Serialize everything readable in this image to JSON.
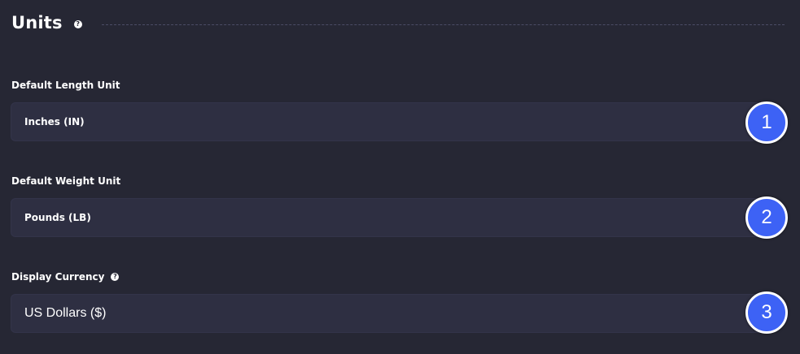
{
  "section": {
    "title": "Units",
    "help_icon": "question-circle-icon"
  },
  "fields": [
    {
      "label": "Default Length Unit",
      "value": "Inches (IN)",
      "marker": "1"
    },
    {
      "label": "Default Weight Unit",
      "value": "Pounds (LB)",
      "marker": "2"
    },
    {
      "label": "Display Currency",
      "value": "US Dollars ($)",
      "marker": "3",
      "help_icon": "question-circle-icon"
    }
  ],
  "colors": {
    "background": "#262734",
    "field_background": "#2e2f42",
    "marker": "#3d62f5",
    "text": "#ffffff"
  }
}
